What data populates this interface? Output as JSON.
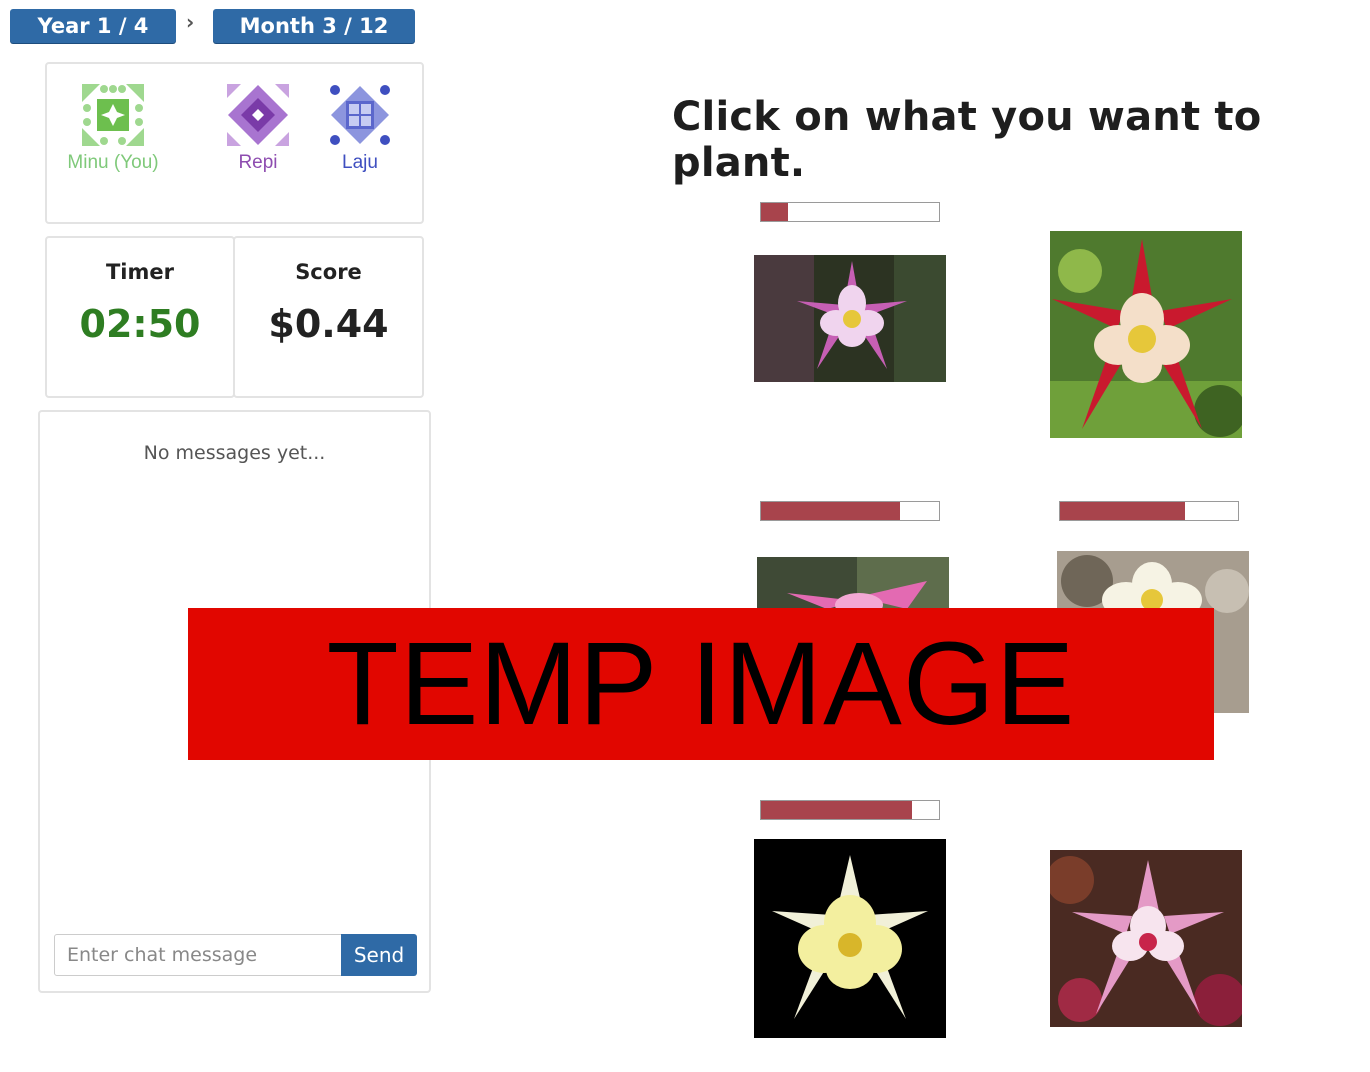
{
  "breadcrumb": {
    "year": "Year 1 / 4",
    "separator": "›",
    "month": "Month 3 / 12"
  },
  "players": [
    {
      "name": "Minu (You)",
      "color": "#7fc97a",
      "icon": "green-quilt-icon"
    },
    {
      "name": "Repi",
      "color": "#8e4db0",
      "icon": "purple-quilt-icon"
    },
    {
      "name": "Laju",
      "color": "#3f4fc0",
      "icon": "blue-quilt-icon"
    }
  ],
  "stats": {
    "timer_label": "Timer",
    "timer_value": "02:50",
    "timer_color": "#2e7d22",
    "score_label": "Score",
    "score_value": "$0.44"
  },
  "chat": {
    "empty_text": "No messages yet...",
    "placeholder": "Enter chat message",
    "send_label": "Send"
  },
  "main": {
    "prompt": "Click on what you want to plant.",
    "plants": [
      {
        "name": "pink-columbine",
        "progress": 0.15
      },
      {
        "name": "red-columbine",
        "progress": null
      },
      {
        "name": "pink-columbine-2",
        "progress": 0.78
      },
      {
        "name": "white-columbine",
        "progress": 0.7
      },
      {
        "name": "yellow-columbine",
        "progress": 0.85
      },
      {
        "name": "pink-double-columbine",
        "progress": null
      }
    ],
    "progress_color": "#a8444c"
  },
  "overlay": {
    "text": "TEMP IMAGE",
    "color": "#e10600"
  }
}
